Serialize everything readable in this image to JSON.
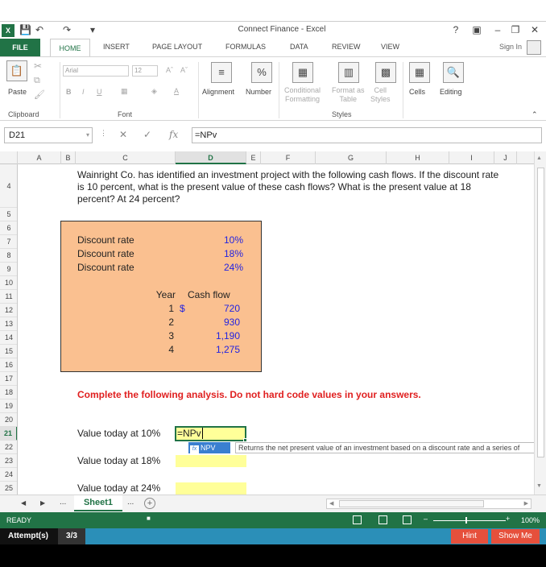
{
  "window": {
    "title": "Connect Finance - Excel",
    "help": "?",
    "signin": "Sign In"
  },
  "tabs": [
    "FILE",
    "HOME",
    "INSERT",
    "PAGE LAYOUT",
    "FORMULAS",
    "DATA",
    "REVIEW",
    "VIEW"
  ],
  "ribbon": {
    "paste": "Paste",
    "clipboard": "Clipboard",
    "font_name": "Arial",
    "font_size": "12",
    "font": "Font",
    "alignment": "Alignment",
    "number": "Number",
    "conditional": "Conditional",
    "formatting": "Formatting",
    "format_as": "Format as",
    "table": "Table",
    "cell": "Cell",
    "styles_btn": "Styles",
    "styles": "Styles",
    "cells": "Cells",
    "editing": "Editing"
  },
  "formula_bar": {
    "name_box": "D21",
    "fx": "fx",
    "formula": "=NPv"
  },
  "columns": [
    "A",
    "B",
    "C",
    "D",
    "E",
    "F",
    "G",
    "H",
    "I",
    "J"
  ],
  "rows": [
    "4",
    "5",
    "6",
    "7",
    "8",
    "9",
    "10",
    "11",
    "12",
    "13",
    "14",
    "15",
    "16",
    "17",
    "18",
    "19",
    "20",
    "21",
    "22",
    "23",
    "24",
    "25"
  ],
  "question": "Wainright Co. has identified an investment project with the following cash flows. If the discount rate is 10 percent, what is the present value of these cash flows? What is the present value at 18 percent? At 24 percent?",
  "discount": {
    "label": "Discount rate",
    "rates": [
      "10%",
      "18%",
      "24%"
    ]
  },
  "cashflow": {
    "year_header": "Year",
    "cf_header": "Cash flow",
    "currency": "$",
    "years": [
      "1",
      "2",
      "3",
      "4"
    ],
    "values": [
      "720",
      "930",
      "1,190",
      "1,275"
    ]
  },
  "instruction": "Complete the following analysis. Do not hard code values in your answers.",
  "answers": {
    "v10": "Value today at 10%",
    "v18": "Value today at 18%",
    "v24": "Value today at 24%",
    "active_input": "=NPv"
  },
  "autocomplete": {
    "item": "NPV",
    "tooltip": "Returns the net present value of an investment based on a discount rate and a series of"
  },
  "sheet": {
    "name": "Sheet1",
    "ellipsis": "..."
  },
  "status": {
    "mode": "READY",
    "zoom": "100%"
  },
  "attempt": {
    "label": "Attempt(s)",
    "count": "3/3",
    "hint": "Hint",
    "show_me": "Show Me"
  }
}
